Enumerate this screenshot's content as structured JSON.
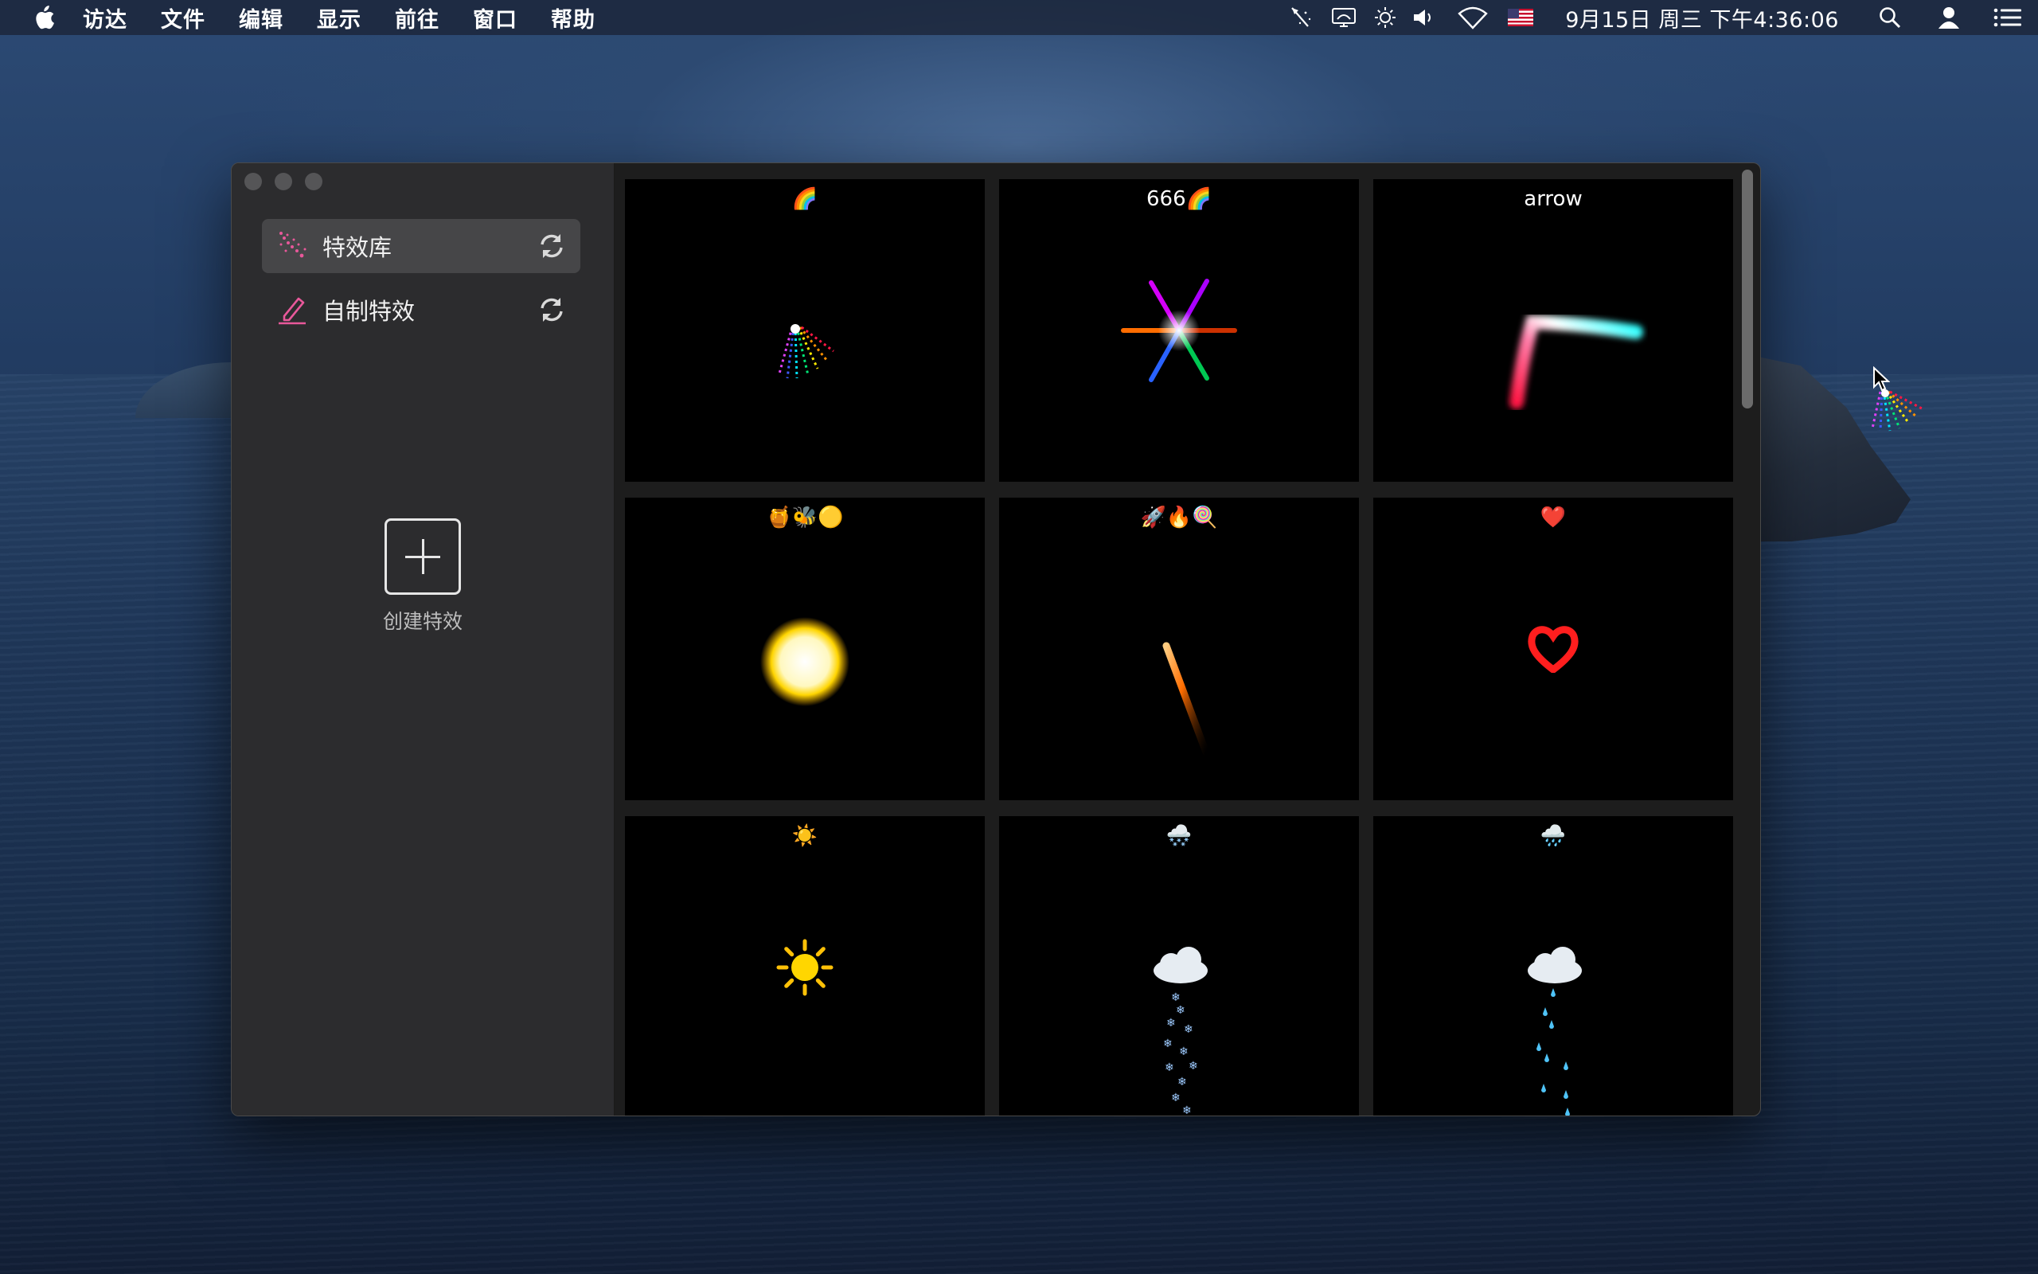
{
  "menubar": {
    "app_name": "访达",
    "items": [
      "文件",
      "编辑",
      "显示",
      "前往",
      "窗口",
      "帮助"
    ],
    "clock": "9月15日 周三 下午4:36:06",
    "status_icons": [
      "magic-wand-icon",
      "display-mirror-icon",
      "brightness-icon",
      "volume-icon",
      "wifi-icon",
      "us-flag-icon",
      "search-icon",
      "user-icon",
      "control-center-icon"
    ]
  },
  "sidebar": {
    "items": [
      {
        "label": "特效库",
        "icon": "sparkle-wand-icon",
        "selected": true
      },
      {
        "label": "自制特效",
        "icon": "pencil-icon",
        "selected": false
      }
    ],
    "create_label": "创建特效"
  },
  "effects": [
    {
      "title": "🌈",
      "icon": "rainbow-sparkle-effect"
    },
    {
      "title": "666🌈",
      "icon": "star-burst-effect"
    },
    {
      "title": "arrow",
      "icon": "boomerang-trail-effect"
    },
    {
      "title": "🍯🐝🟡",
      "icon": "glowing-sun-ball-effect"
    },
    {
      "title": "🚀🔥🍭",
      "icon": "rocket-streak-effect"
    },
    {
      "title": "❤️",
      "icon": "heart-effect"
    },
    {
      "title": "☀️",
      "icon": "sun-effect"
    },
    {
      "title": "🌨️",
      "icon": "snow-cloud-effect"
    },
    {
      "title": "🌧️",
      "icon": "rain-cloud-effect"
    }
  ],
  "colors": {
    "accent_pink": "#e8589a",
    "window_bg": "#1d1d1d",
    "sidebar_bg": "#2c2c2e",
    "selected_bg": "#464648"
  }
}
